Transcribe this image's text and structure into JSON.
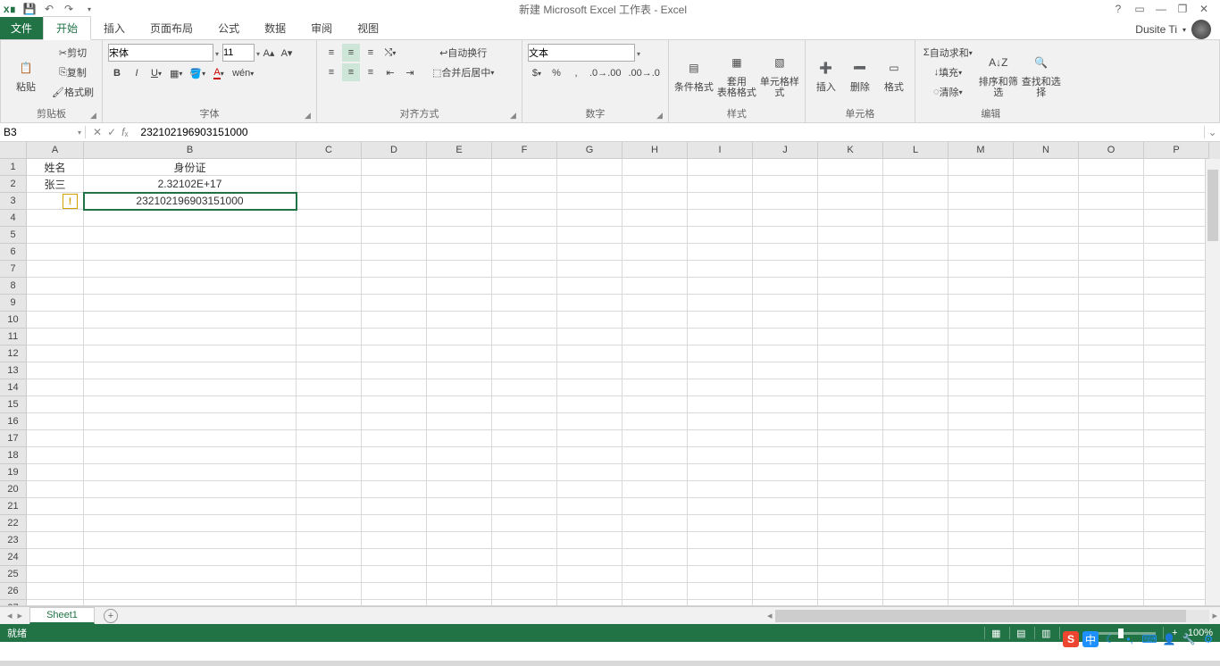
{
  "title": "新建 Microsoft Excel 工作表 - Excel",
  "user": "Dusite Ti",
  "tabs": {
    "file": "文件",
    "home": "开始",
    "insert": "插入",
    "layout": "页面布局",
    "formulas": "公式",
    "data": "数据",
    "review": "审阅",
    "view": "视图"
  },
  "clipboard": {
    "paste": "粘贴",
    "cut": "剪切",
    "copy": "复制",
    "painter": "格式刷",
    "group": "剪贴板"
  },
  "font": {
    "name": "宋体",
    "size": "11",
    "group": "字体"
  },
  "align": {
    "wrap": "自动换行",
    "merge": "合并后居中",
    "group": "对齐方式"
  },
  "number": {
    "format": "文本",
    "group": "数字"
  },
  "styles": {
    "cond": "条件格式",
    "table": "套用\n表格格式",
    "cell": "单元格样式",
    "group": "样式"
  },
  "cells": {
    "insert": "插入",
    "delete": "删除",
    "format": "格式",
    "group": "单元格"
  },
  "editing": {
    "sum": "自动求和",
    "fill": "填充",
    "clear": "清除",
    "sort": "排序和筛选",
    "find": "查找和选择",
    "group": "编辑"
  },
  "namebox": "B3",
  "formula": "232102196903151000",
  "columns": [
    "A",
    "B",
    "C",
    "D",
    "E",
    "F",
    "G",
    "H",
    "I",
    "J",
    "K",
    "L",
    "M",
    "N",
    "O",
    "P"
  ],
  "rows": 27,
  "data_cells": {
    "A1": "姓名",
    "B1": "身份证",
    "A2": "张三",
    "B2": "2.32102E+17",
    "B3": "232102196903151000"
  },
  "selected": "B3",
  "sheet": "Sheet1",
  "status": "就绪",
  "zoom": "100%"
}
